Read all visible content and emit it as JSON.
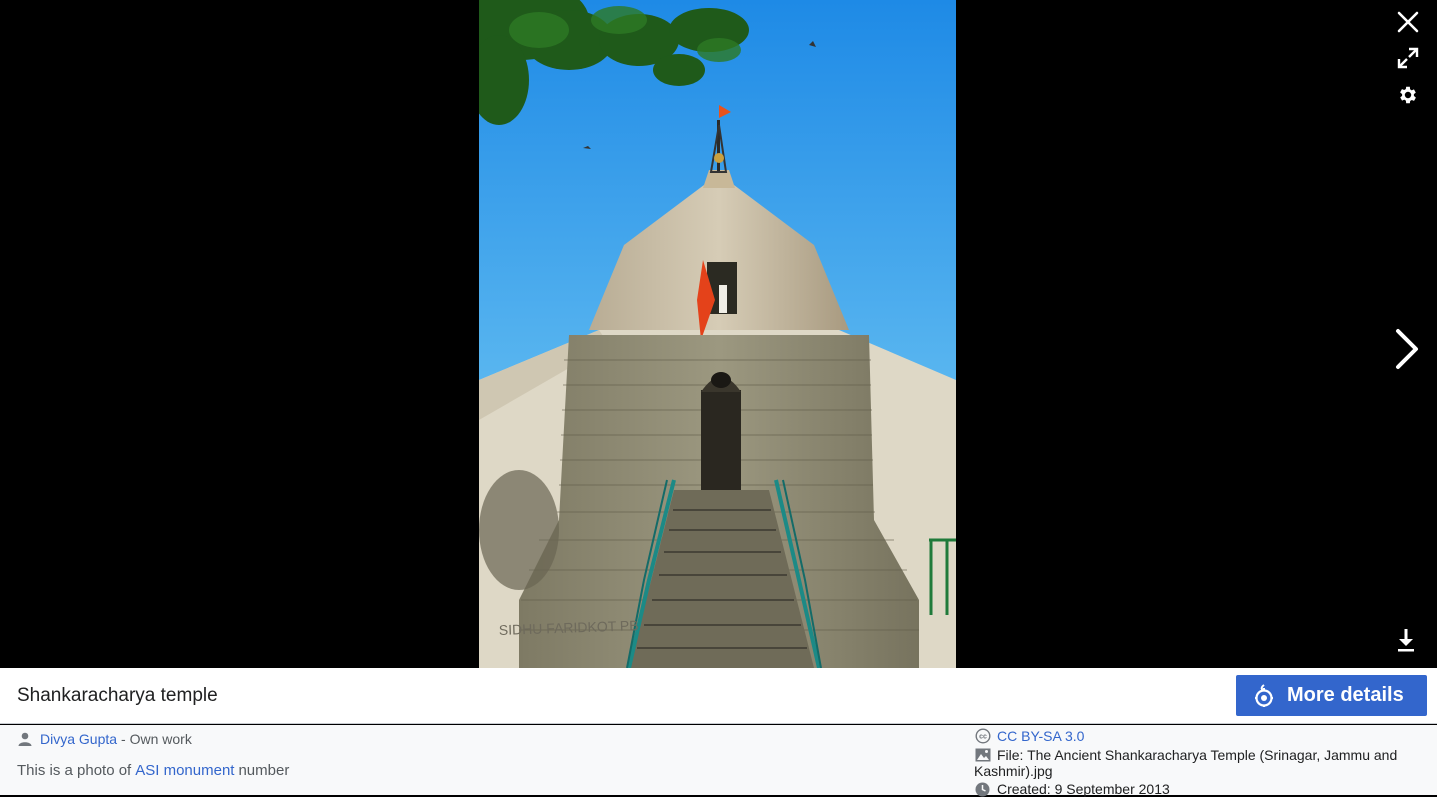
{
  "viewer": {
    "controls": {
      "close_icon": "close-icon",
      "fullscreen_icon": "fullscreen-icon",
      "settings_icon": "gear-icon",
      "next_icon": "chevron-right-icon",
      "download_icon": "download-icon"
    },
    "image": {
      "inscription": "SIDHU FARIDKOT PB"
    }
  },
  "title_bar": {
    "title": "Shankaracharya temple",
    "more_details_label": "More details",
    "accent": "#3366cc"
  },
  "meta": {
    "author": "Divya Gupta",
    "author_suffix": "- Own work",
    "desc_prefix": "This is a photo of",
    "desc_link": "ASI monument",
    "desc_suffix": "number",
    "license": "CC BY-SA 3.0",
    "file": "File: The Ancient Shankaracharya Temple (Srinagar, Jammu and Kashmir).jpg",
    "created": "Created: 9 September 2013"
  }
}
